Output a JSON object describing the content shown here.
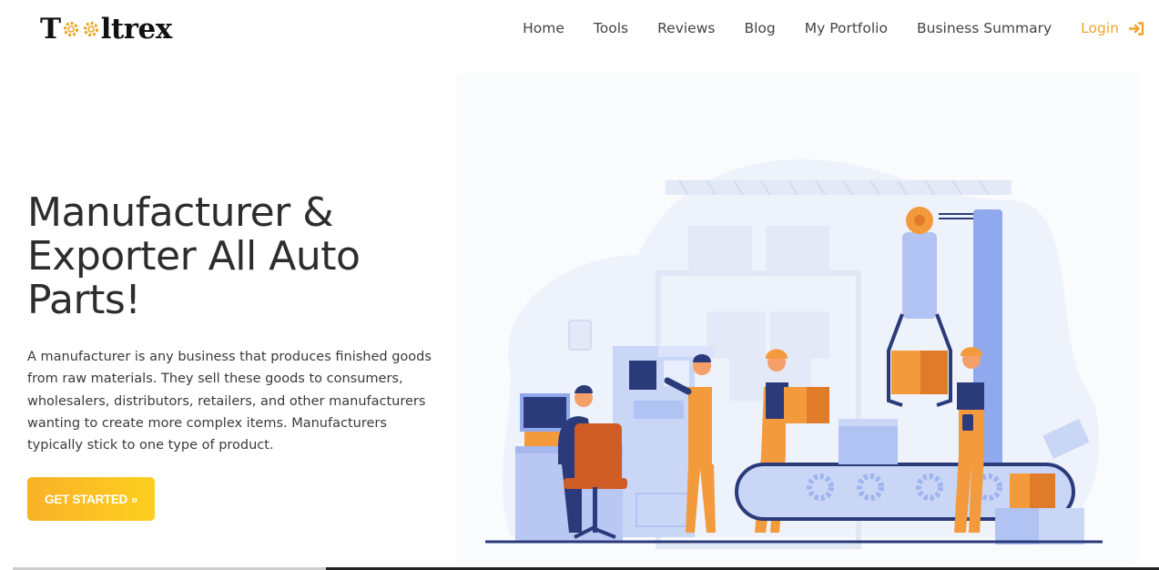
{
  "brand": {
    "logo_start": "T",
    "logo_end": "ltrex"
  },
  "nav": {
    "items": [
      "Home",
      "Tools",
      "Reviews",
      "Blog",
      "My Portfolio",
      "Business Summary"
    ],
    "login_label": "Login",
    "login_icon": "sign-in-icon",
    "accent_color": "#f0a52a"
  },
  "hero": {
    "title": "Manufacturer & Exporter All Auto Parts!",
    "description": "A manufacturer is any business that produces finished goods from raw materials. They sell these goods to consumers, wholesalers, distributors, retailers, and other manufacturers wanting to create more complex items. Manufacturers typically stick to one type of product.",
    "cta_label": "GET STARTED",
    "cta_icon": "double-chevron-right-icon",
    "cta_color_start": "#f9b227",
    "cta_color_end": "#fdcf1f"
  },
  "illustration": {
    "icon": "factory-assembly-line-illustration",
    "primary_color": "#f39a3d",
    "secondary_color": "#8fa8ee",
    "worker_color": "#2b3b7a"
  }
}
